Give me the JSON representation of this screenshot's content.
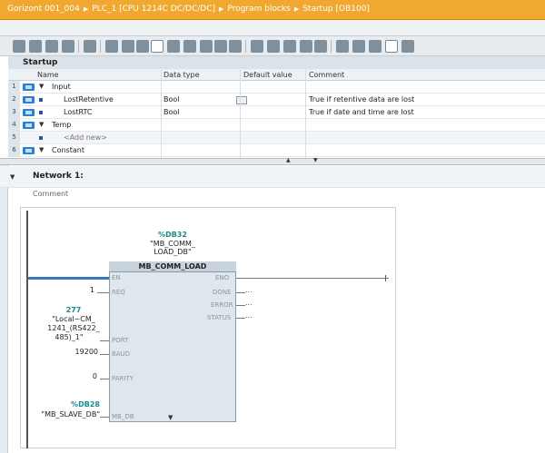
{
  "breadcrumb": [
    "Gorizont 001_004",
    "PLC_1 [CPU 1214C DC/DC/DC]",
    "Program blocks",
    "Startup [OB100]"
  ],
  "block": {
    "name": "Startup",
    "columns": [
      "Name",
      "Data type",
      "Default value",
      "Comment"
    ],
    "rows": [
      {
        "num": "1",
        "name": "Input",
        "kind": "section",
        "type": "",
        "comment": ""
      },
      {
        "num": "2",
        "name": "LostRetentive",
        "kind": "var",
        "type": "Bool",
        "comment": "True if retentive data are lost"
      },
      {
        "num": "3",
        "name": "LostRTC",
        "kind": "var",
        "type": "Bool",
        "comment": "True if date and time are lost"
      },
      {
        "num": "4",
        "name": "Temp",
        "kind": "section",
        "type": "",
        "comment": ""
      },
      {
        "num": "5",
        "name": "<Add new>",
        "kind": "add",
        "type": "",
        "comment": ""
      },
      {
        "num": "6",
        "name": "Constant",
        "kind": "section",
        "type": "",
        "comment": ""
      }
    ]
  },
  "network": {
    "title": "Network 1:",
    "comment_label": "Comment",
    "instance": {
      "address": "%DB32",
      "name1": "\"MB_COMM_",
      "name2": "LOAD_DB\""
    },
    "fb_name": "MB_COMM_LOAD",
    "inputs": [
      {
        "pin": "EN",
        "value": ""
      },
      {
        "pin": "REQ",
        "value": "1"
      },
      {
        "pin": "PORT",
        "value": "277"
      },
      {
        "pin": "BAUD",
        "value": "19200"
      },
      {
        "pin": "PARITY",
        "value": "0"
      },
      {
        "pin": "MB_DB",
        "value": ""
      }
    ],
    "port_label": [
      "\"Local~CM_",
      "1241_(RS422_",
      "485)_1\""
    ],
    "mbdb": {
      "address": "%DB28",
      "name": "\"MB_SLAVE_DB\""
    },
    "outputs": [
      "ENO",
      "DONE",
      "ERROR",
      "STATUS"
    ],
    "output_dots": "..."
  },
  "colors": {
    "title_bar": "#f0a830",
    "accent_blue": "#2a7fd4",
    "teal": "#1a8a8a"
  }
}
